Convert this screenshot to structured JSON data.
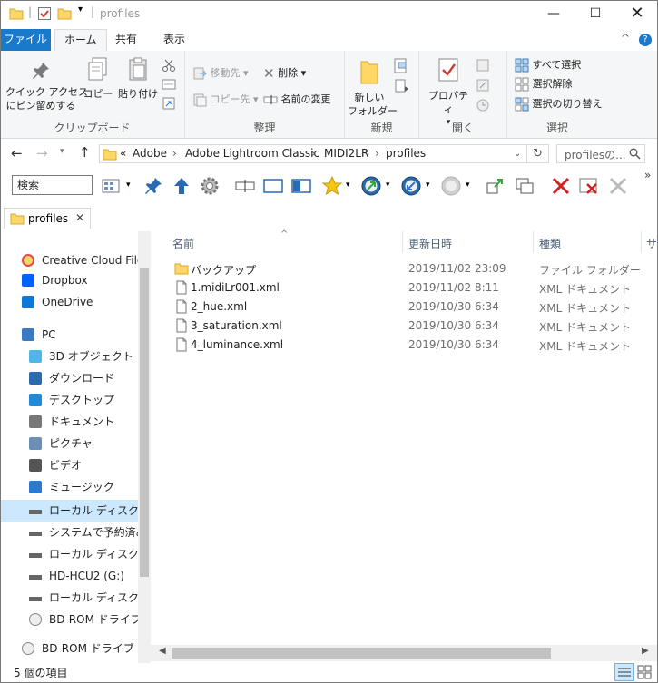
{
  "window": {
    "title": "profiles",
    "controls": [
      "minimize",
      "maximize",
      "close"
    ]
  },
  "ribbon_tabs": [
    {
      "label": "ファイル"
    },
    {
      "label": "ホーム"
    },
    {
      "label": "共有"
    },
    {
      "label": "表示"
    }
  ],
  "ribbon": {
    "clipboard": {
      "group_label": "クリップボード",
      "pin_label": "クイック アクセス\nにピン留めする",
      "copy_label": "コピー",
      "paste_label": "貼り付け"
    },
    "organize": {
      "group_label": "整理",
      "move_to": "移動先",
      "copy_to": "コピー先",
      "delete": "削除",
      "rename": "名前の変更"
    },
    "new": {
      "group_label": "新規",
      "new_folder": "新しい\nフォルダー"
    },
    "open": {
      "group_label": "開く",
      "properties": "プロパティ"
    },
    "select": {
      "group_label": "選択",
      "select_all": "すべて選択",
      "select_none": "選択解除",
      "invert": "選択の切り替え"
    }
  },
  "address": {
    "prefix": "«",
    "crumbs": [
      "Adobe",
      "Adobe Lightroom Classic",
      "MIDI2LR",
      "profiles"
    ],
    "search_placeholder": "profilesの..."
  },
  "toolbar": {
    "search_text": "検索"
  },
  "path_tab": {
    "label": "profiles"
  },
  "nav_items": [
    {
      "label": "Creative Cloud Files",
      "icon": "creative-cloud-icon"
    },
    {
      "label": "Dropbox",
      "icon": "dropbox-icon"
    },
    {
      "label": "OneDrive",
      "icon": "onedrive-icon"
    },
    {
      "label": "PC",
      "icon": "pc-icon"
    },
    {
      "label": "3D オブジェクト",
      "icon": "3d-objects-icon"
    },
    {
      "label": "ダウンロード",
      "icon": "download-icon"
    },
    {
      "label": "デスクトップ",
      "icon": "desktop-icon"
    },
    {
      "label": "ドキュメント",
      "icon": "documents-icon"
    },
    {
      "label": "ピクチャ",
      "icon": "pictures-icon"
    },
    {
      "label": "ビデオ",
      "icon": "videos-icon"
    },
    {
      "label": "ミュージック",
      "icon": "music-icon"
    },
    {
      "label": "ローカル ディスク (C:)",
      "icon": "drive-icon"
    },
    {
      "label": "システムで予約済み",
      "icon": "drive-icon"
    },
    {
      "label": "ローカル ディスク (F:)",
      "icon": "drive-icon"
    },
    {
      "label": "HD-HCU2 (G:)",
      "icon": "drive-icon"
    },
    {
      "label": "ローカル ディスク (H:)",
      "icon": "drive-icon"
    },
    {
      "label": "BD-ROM ドライブ (I:",
      "icon": "disc-icon"
    },
    {
      "label": "BD-ROM ドライブ (I:) ",
      "icon": "disc-icon"
    }
  ],
  "columns": {
    "name": "名前",
    "date": "更新日時",
    "type": "種類",
    "size": "サ"
  },
  "files": [
    {
      "name": "バックアップ",
      "date": "2019/11/02 23:09",
      "type": "ファイル フォルダー",
      "kind": "folder"
    },
    {
      "name": "1.midiLr001.xml",
      "date": "2019/11/02 8:11",
      "type": "XML ドキュメント",
      "kind": "file"
    },
    {
      "name": "2_hue.xml",
      "date": "2019/10/30 6:34",
      "type": "XML ドキュメント",
      "kind": "file"
    },
    {
      "name": "3_saturation.xml",
      "date": "2019/10/30 6:34",
      "type": "XML ドキュメント",
      "kind": "file"
    },
    {
      "name": "4_luminance.xml",
      "date": "2019/10/30 6:34",
      "type": "XML ドキュメント",
      "kind": "file"
    }
  ],
  "status": {
    "item_count": "5 個の項目"
  },
  "colors": {
    "file_tab": "#1979ca",
    "selection": "#cce8ff",
    "folder": "#ffd766"
  }
}
